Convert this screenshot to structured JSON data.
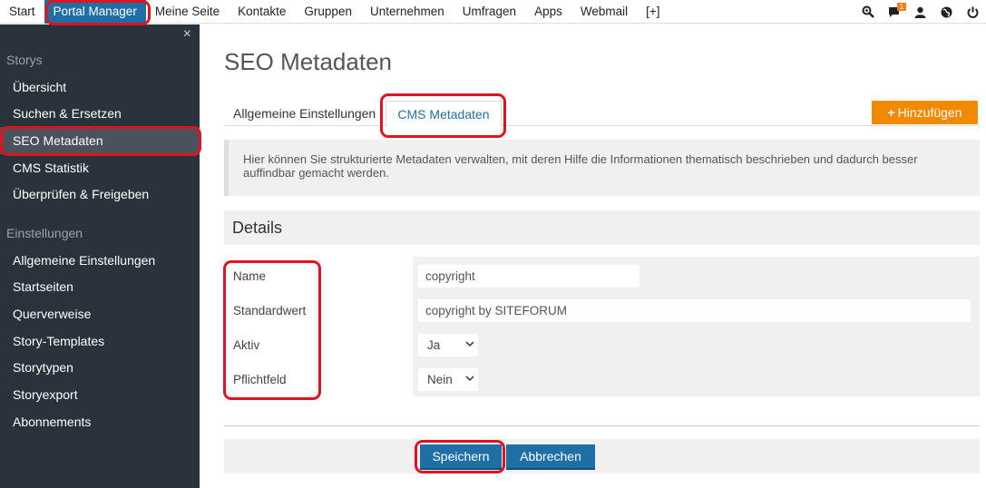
{
  "topnav": {
    "items": [
      {
        "label": "Start"
      },
      {
        "label": "Portal Manager"
      },
      {
        "label": "Meine Seite"
      },
      {
        "label": "Kontakte"
      },
      {
        "label": "Gruppen"
      },
      {
        "label": "Unternehmen"
      },
      {
        "label": "Umfragen"
      },
      {
        "label": "Apps"
      },
      {
        "label": "Webmail"
      },
      {
        "label": "[+]"
      }
    ],
    "notification_count": "1",
    "icons": [
      "search-icon",
      "chat-icon",
      "user-icon",
      "globe-icon",
      "power-icon"
    ]
  },
  "sidebar": {
    "close_symbol": "×",
    "sections": [
      {
        "title": "Storys",
        "items": [
          {
            "label": "Übersicht"
          },
          {
            "label": "Suchen & Ersetzen"
          },
          {
            "label": "SEO Metadaten"
          },
          {
            "label": "CMS Statistik"
          },
          {
            "label": "Überprüfen & Freigeben"
          }
        ]
      },
      {
        "title": "Einstellungen",
        "items": [
          {
            "label": "Allgemeine Einstellungen"
          },
          {
            "label": "Startseiten"
          },
          {
            "label": "Querverweise"
          },
          {
            "label": "Story-Templates"
          },
          {
            "label": "Storytypen"
          },
          {
            "label": "Storyexport"
          },
          {
            "label": "Abonnements"
          }
        ]
      }
    ]
  },
  "main": {
    "title": "SEO Metadaten",
    "tabs": [
      {
        "label": "Allgemeine Einstellungen"
      },
      {
        "label": "CMS Metadaten"
      }
    ],
    "add_button": "Hinzufügen",
    "info_text": "Hier können Sie strukturierte Metadaten verwalten, mit deren Hilfe die Informationen thematisch beschrieben und dadurch besser auffindbar gemacht werden.",
    "details": {
      "heading": "Details",
      "fields": {
        "name": {
          "label": "Name",
          "value": "copyright"
        },
        "default": {
          "label": "Standardwert",
          "value": "copyright by SITEFORUM"
        },
        "active": {
          "label": "Aktiv",
          "value": "Ja"
        },
        "required": {
          "label": "Pflichtfeld",
          "value": "Nein"
        }
      }
    },
    "save_button": "Speichern",
    "cancel_button": "Abbrechen"
  },
  "colors": {
    "accent": "#1f6fa7",
    "sidebar_bg": "#2a323c",
    "sidebar_active": "#4a525c",
    "add_button": "#f08a00",
    "highlight": "#e0141e"
  }
}
